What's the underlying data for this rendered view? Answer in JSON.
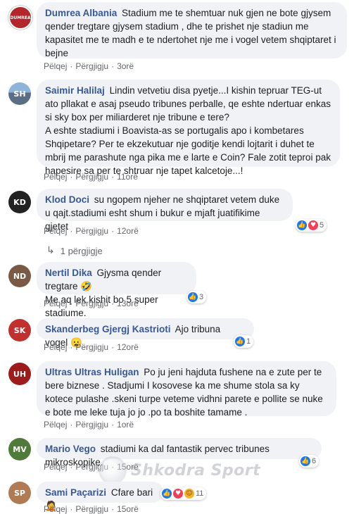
{
  "actions": {
    "like": "Pëlqej",
    "reply": "Përgjigju"
  },
  "comments": [
    {
      "author": "Dumrea Albania",
      "text": "Stadium me te shemtuar nuk gjen ne bote gjysem qender tregtare gjysem stadium , dhe te prishet nje stadiun me kapasitet me te madh e te ndertohet nje me i vogel vetem shqiptaret i bejne",
      "time": "3orë",
      "avatar_label": "DUMREA",
      "avatar_color": "#b3262b"
    },
    {
      "author": "Saimir Halilaj",
      "text": "Lindin vetvetiu disa pyetje...I kishin tepruar TEG-ut ato pllakat e asaj pseudo tribunes perballe, qe eshte ndertuar enkas si sky box per miliarderet nje tribune e tere?\nA eshte stadiumi i Boavista-as se portugalis apo i kombetares Shqipetare? Per te ekzekutuar nje goditje kendi lojtarit i duhet te mbrij me parashute nga pika me e larte e Coin? Fale zotit teproi pak hapesire sa per te shtruar nje tapet kalcetoje...!",
      "time": "11orë",
      "avatar_label": "SH",
      "avatar_color": "#5a6f86"
    },
    {
      "author": "Klod Doci",
      "text": "su ngopem njeher ne shqiptaret vetem duke u qajt.stadiumi esht shum i bukur e mjaft juatifikime gjetet",
      "time": "12orë",
      "avatar_label": "KD",
      "avatar_color": "#222222",
      "reaction_count": "5"
    },
    {
      "author": "Nertil Dika",
      "text": "Gjysma qender tregtare 🤣\nMe aq lek kishit bo 5 super stadiume.",
      "time": "13orë",
      "avatar_label": "ND",
      "avatar_color": "#7a5a45",
      "reaction_count": "3"
    },
    {
      "author": "Skanderbeg Gjergj Kastrioti",
      "text": "Ajo tribuna vogel 😦",
      "time": "12orë",
      "avatar_label": "SK",
      "avatar_color": "#c0302f",
      "reaction_count": "1"
    },
    {
      "author": "Ultras Ultras Huligan",
      "text": "Po ju jeni hajduta fushene na e zute per te bere bizne­se . Stadjumi I kosovese ka me shume stola sa ky kotece pulashe .skeni turpe veteme vidhni parete e pollite se nuke e bote me leke tuja jo jo .po ta boshite tamame .",
      "time": "1orë",
      "avatar_label": "UH",
      "avatar_color": "#9e1b1b"
    },
    {
      "author": "Mario Vego",
      "text": "stadiumi ka dal fantastik pervec tribunes mikroskopike.",
      "time": "15orë",
      "avatar_label": "MV",
      "avatar_color": "#4f7a3a",
      "reaction_count": "6"
    },
    {
      "author": "Sami Paçarizi",
      "text": "Cfare bari 🤦",
      "time": "15orë",
      "avatar_label": "SP",
      "avatar_color": "#b07a55",
      "reaction_count": "11"
    }
  ],
  "replies": {
    "label": "1 përgjigje"
  },
  "watermark": {
    "text": "Shkodra Sport"
  }
}
